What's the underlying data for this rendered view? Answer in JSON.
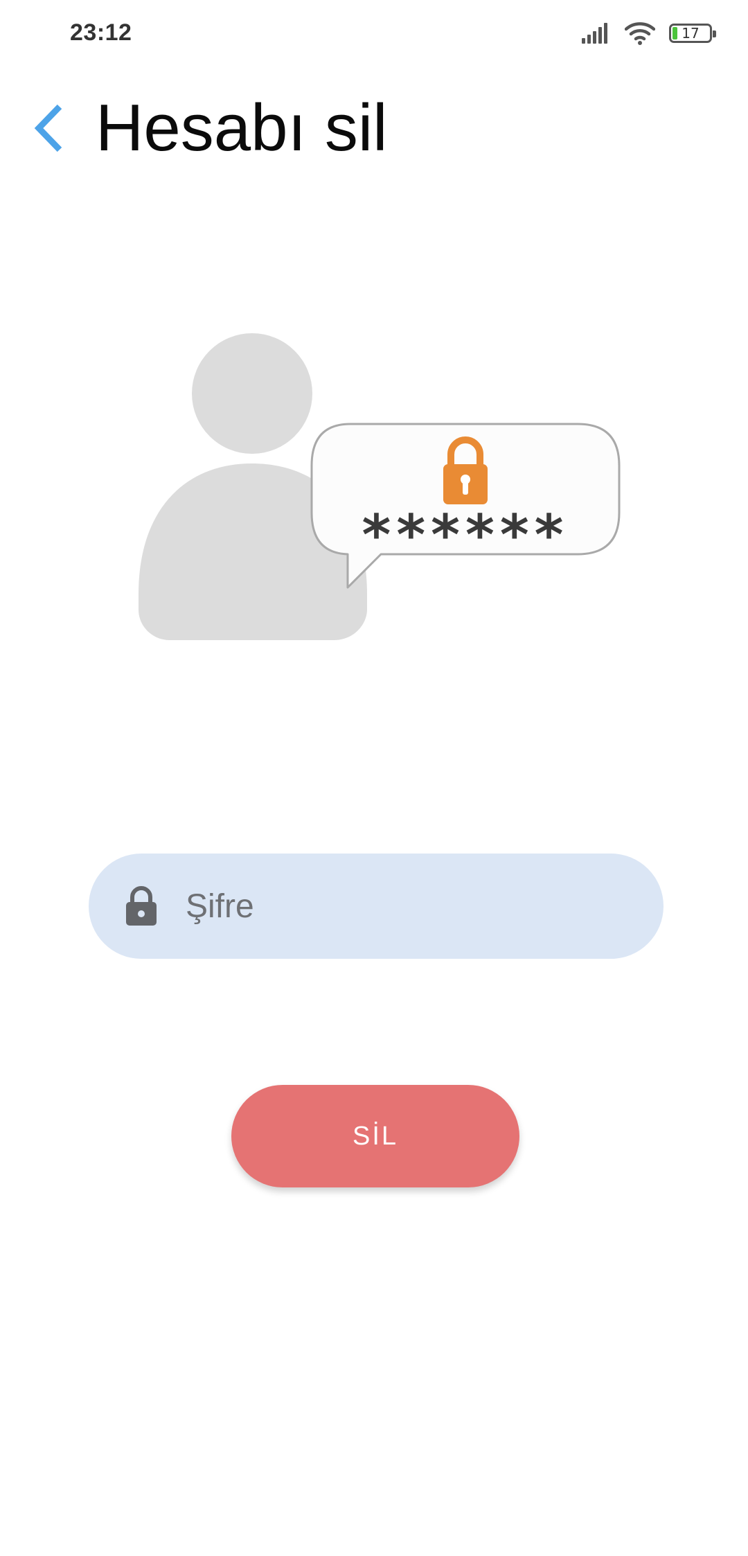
{
  "status_bar": {
    "time": "23:12",
    "battery_level": "17",
    "icons": [
      "signal-icon",
      "wifi-icon",
      "battery-icon"
    ]
  },
  "header": {
    "title": "Hesabı sil",
    "back_icon": "chevron-left-icon"
  },
  "illustration": {
    "masked_password": "******",
    "icons": [
      "user-silhouette-icon",
      "padlock-icon"
    ]
  },
  "form": {
    "password_placeholder": "Şifre",
    "password_value": "",
    "password_icon": "lock-icon"
  },
  "actions": {
    "delete_label": "SİL"
  },
  "colors": {
    "accent_blue": "#4da3e8",
    "field_background": "#dbe6f5",
    "delete_button": "#e57373",
    "padlock_orange": "#e98b34",
    "silhouette_gray": "#dcdcdc"
  }
}
